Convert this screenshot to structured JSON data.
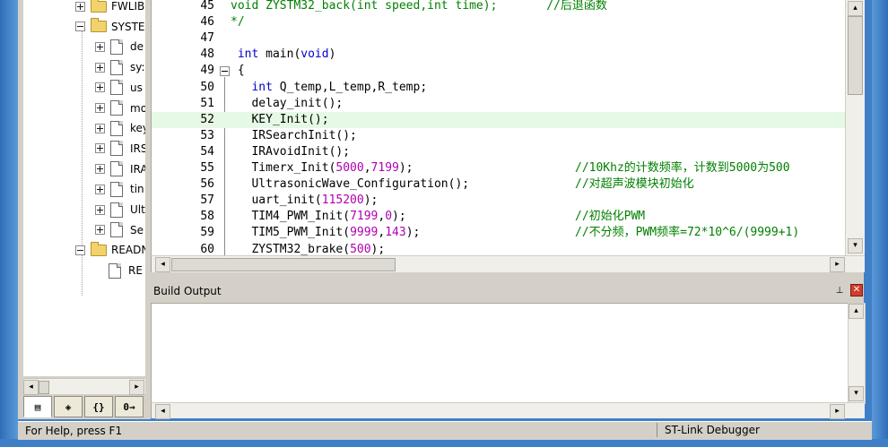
{
  "project_tree": {
    "items": [
      {
        "label": "FWLIB",
        "type": "folder",
        "expander": "plus"
      },
      {
        "label": "SYSTE",
        "type": "folder",
        "expander": "minus"
      },
      {
        "label": "de",
        "type": "file",
        "expander": "plus"
      },
      {
        "label": "sy:",
        "type": "file",
        "expander": "plus"
      },
      {
        "label": "us",
        "type": "file",
        "expander": "plus"
      },
      {
        "label": "mo",
        "type": "file",
        "expander": "plus"
      },
      {
        "label": "key",
        "type": "file",
        "expander": "plus"
      },
      {
        "label": "IRS",
        "type": "file",
        "expander": "plus"
      },
      {
        "label": "IRA",
        "type": "file",
        "expander": "plus"
      },
      {
        "label": "tin",
        "type": "file",
        "expander": "plus"
      },
      {
        "label": "Ult",
        "type": "file",
        "expander": "plus"
      },
      {
        "label": "Se",
        "type": "file",
        "expander": "plus"
      },
      {
        "label": "READN",
        "type": "folder",
        "expander": "minus"
      },
      {
        "label": "RE",
        "type": "file",
        "expander": "none"
      }
    ],
    "tabs": [
      "project-tab",
      "books-tab",
      "functions-tab",
      "templates-tab"
    ],
    "tab_labels": [
      "▤",
      "◈",
      "{}",
      "0→"
    ]
  },
  "editor": {
    "current_line": "52",
    "lines": [
      {
        "num": "45",
        "code": "void ZYSTM32_back(int speed,int time);       //后退函数",
        "style": "comment"
      },
      {
        "num": "46",
        "code": "*/",
        "style": "comment"
      },
      {
        "num": "47",
        "code": "",
        "style": "plain"
      },
      {
        "num": "48",
        "code": " int main(void)",
        "style": "main"
      },
      {
        "num": "49",
        "code": " {",
        "style": "plain"
      },
      {
        "num": "50",
        "code": "   int Q_temp,L_temp,R_temp;",
        "style": "decl"
      },
      {
        "num": "51",
        "code": "   delay_init();",
        "style": "plain"
      },
      {
        "num": "52",
        "code": "   KEY_Init();",
        "style": "plain"
      },
      {
        "num": "53",
        "code": "   IRSearchInit();",
        "style": "plain"
      },
      {
        "num": "54",
        "code": "   IRAvoidInit();",
        "style": "plain"
      },
      {
        "num": "55",
        "code": "   Timerx_Init(5000,7199);",
        "comment": "//10Khz的计数频率，计数到5000为500",
        "style": "call"
      },
      {
        "num": "56",
        "code": "   UltrasonicWave_Configuration();",
        "comment": "//对超声波模块初始化",
        "style": "call"
      },
      {
        "num": "57",
        "code": "   uart_init(115200);",
        "style": "call"
      },
      {
        "num": "58",
        "code": "   TIM4_PWM_Init(7199,0);",
        "comment": "//初始化PWM",
        "style": "call"
      },
      {
        "num": "59",
        "code": "   TIM5_PWM_Init(9999,143);",
        "comment": "//不分频，PWM频率=72*10^6/(9999+1)",
        "style": "call"
      },
      {
        "num": "60",
        "code": "   ZYSTM32_brake(500);",
        "style": "call"
      }
    ]
  },
  "build_output": {
    "title": "Build Output",
    "pin_icon": "⊥",
    "close_icon": "✕",
    "content": ""
  },
  "statusbar": {
    "help": "For Help, press F1",
    "debugger": "ST-Link Debugger"
  },
  "scroll": {
    "left": "◂",
    "right": "▸",
    "up": "▴",
    "down": "▾"
  },
  "colors": {
    "keyword": "#0000d0",
    "number": "#b000b0",
    "comment": "#008000",
    "current_line": "#e6f8e6"
  }
}
